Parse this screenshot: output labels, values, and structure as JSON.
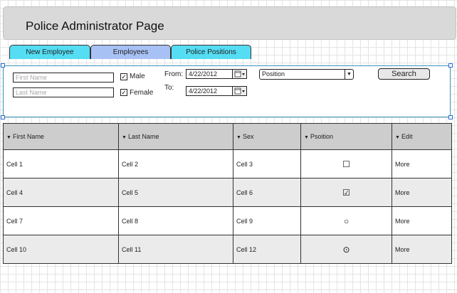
{
  "header": {
    "title": "Police Administrator Page"
  },
  "tabs": [
    {
      "label": "New Employee"
    },
    {
      "label": "Employees"
    },
    {
      "label": "Police Positions"
    }
  ],
  "filter": {
    "first_name_placeholder": "First Name",
    "last_name_placeholder": "Last Name",
    "male_label": "Male",
    "female_label": "Female",
    "male_checked": true,
    "female_checked": true,
    "from_label": "From:",
    "to_label": "To:",
    "from_date": "4/22/2012",
    "to_date": "4/22/2012",
    "position_select": "Position",
    "search_label": "Search"
  },
  "table": {
    "columns": [
      "First Name",
      "Last Name",
      "Sex",
      "Psoition",
      "Edit"
    ],
    "rows": [
      {
        "first": "Cell 1",
        "last": "Cell 2",
        "sex": "Cell 3",
        "position_icon": "☐",
        "edit": "More"
      },
      {
        "first": "Cell 4",
        "last": "Cell 5",
        "sex": "Cell 6",
        "position_icon": "☑",
        "edit": "More"
      },
      {
        "first": "Cell 7",
        "last": "Cell 8",
        "sex": "Cell 9",
        "position_icon": "○",
        "edit": "More"
      },
      {
        "first": "Cell 10",
        "last": "Cell 11",
        "sex": "Cell 12",
        "position_icon": "⊙",
        "edit": "More"
      }
    ]
  },
  "icons": {
    "sort": "▼",
    "dropdown": "▼",
    "calendar": "calendar-icon",
    "check": "✓"
  },
  "colors": {
    "tab_active": "#a8c1f5",
    "tab_inactive": "#54ddf3",
    "selection_border": "#3a95b5",
    "header_bg": "#d9d9d9"
  }
}
